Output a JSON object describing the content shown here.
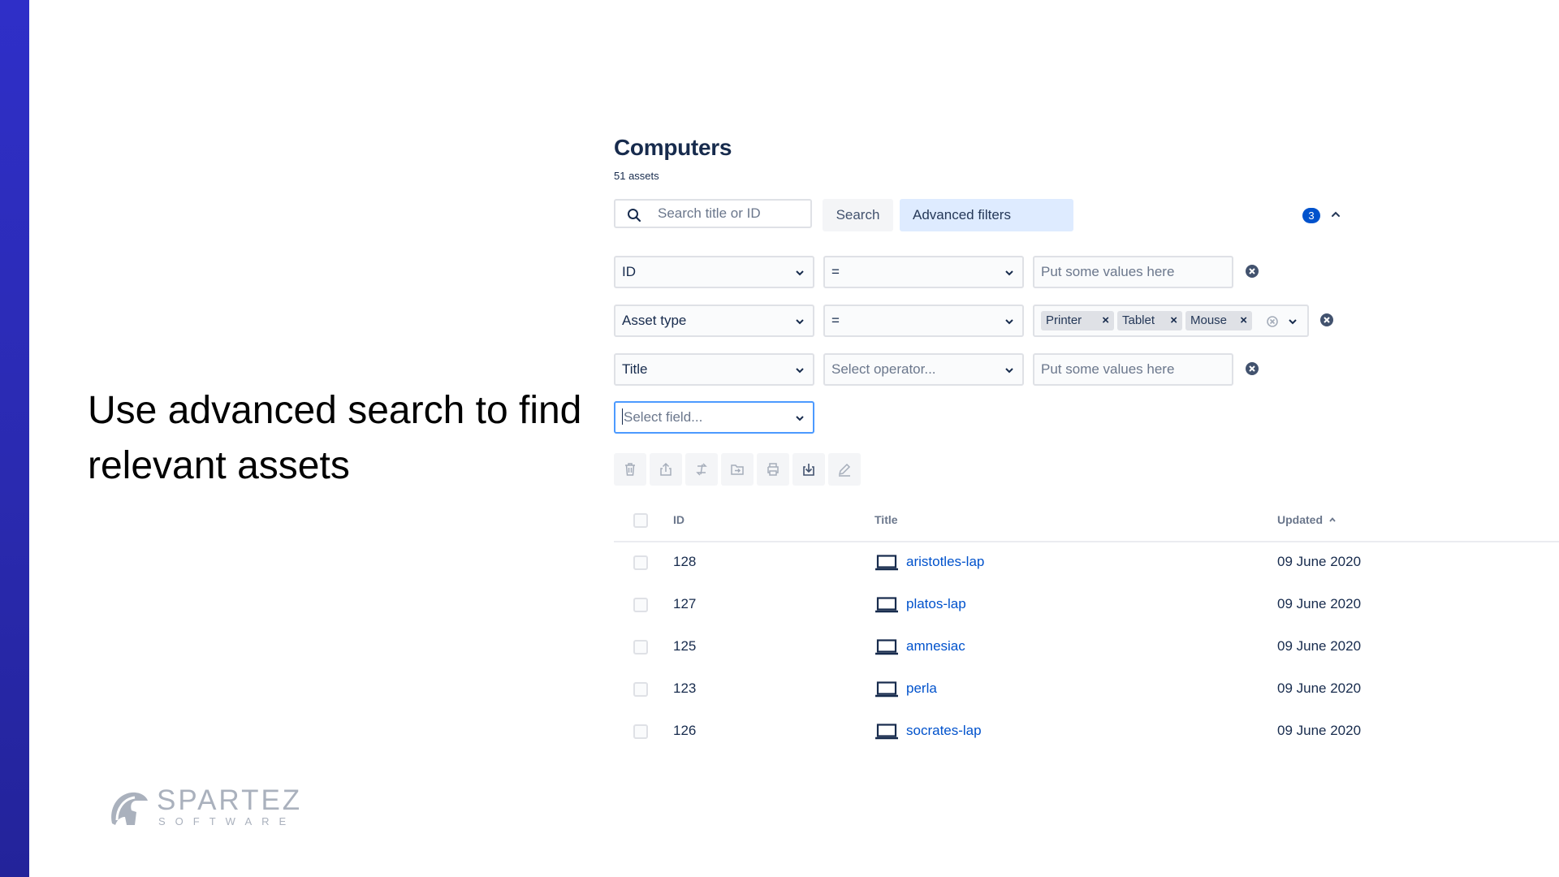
{
  "slide": {
    "heading": "Use advanced search to find relevant assets",
    "brand": {
      "name": "SPARTEZ",
      "tagline": "SOFTWARE"
    }
  },
  "colors": {
    "accent_bar": "#2a2ab0",
    "link": "#0052cc",
    "badge": "#0052cc",
    "adv_bg": "#deebff"
  },
  "page": {
    "title": "Computers",
    "count": "51 assets"
  },
  "search": {
    "placeholder": "Search title or ID",
    "button": "Search",
    "icon": "search-icon"
  },
  "advanced_filters": {
    "label": "Advanced filters",
    "badge": "3",
    "icon": "chevron-up-icon"
  },
  "filters": [
    {
      "field": "ID",
      "operator": "=",
      "value_placeholder": "Put some values here"
    },
    {
      "field": "Asset type",
      "operator": "=",
      "chips": [
        "Printer",
        "Tablet",
        "Mouse"
      ]
    },
    {
      "field": "Title",
      "operator_placeholder": "Select operator...",
      "value_placeholder": "Put some values here"
    }
  ],
  "new_filter": {
    "placeholder": "Select field..."
  },
  "toolbar": [
    "trash-icon",
    "share-icon",
    "transfer-icon",
    "move-icon",
    "print-icon",
    "download-icon",
    "edit-icon"
  ],
  "table": {
    "headers": {
      "id": "ID",
      "title": "Title",
      "updated": "Updated"
    },
    "sort": "Updated ascending",
    "rows": [
      {
        "id": "128",
        "title": "aristotles-lap",
        "updated": "09 June 2020"
      },
      {
        "id": "127",
        "title": "platos-lap",
        "updated": "09 June 2020"
      },
      {
        "id": "125",
        "title": "amnesiac",
        "updated": "09 June 2020"
      },
      {
        "id": "123",
        "title": "perla",
        "updated": "09 June 2020"
      },
      {
        "id": "126",
        "title": "socrates-lap",
        "updated": "09 June 2020"
      }
    ]
  }
}
